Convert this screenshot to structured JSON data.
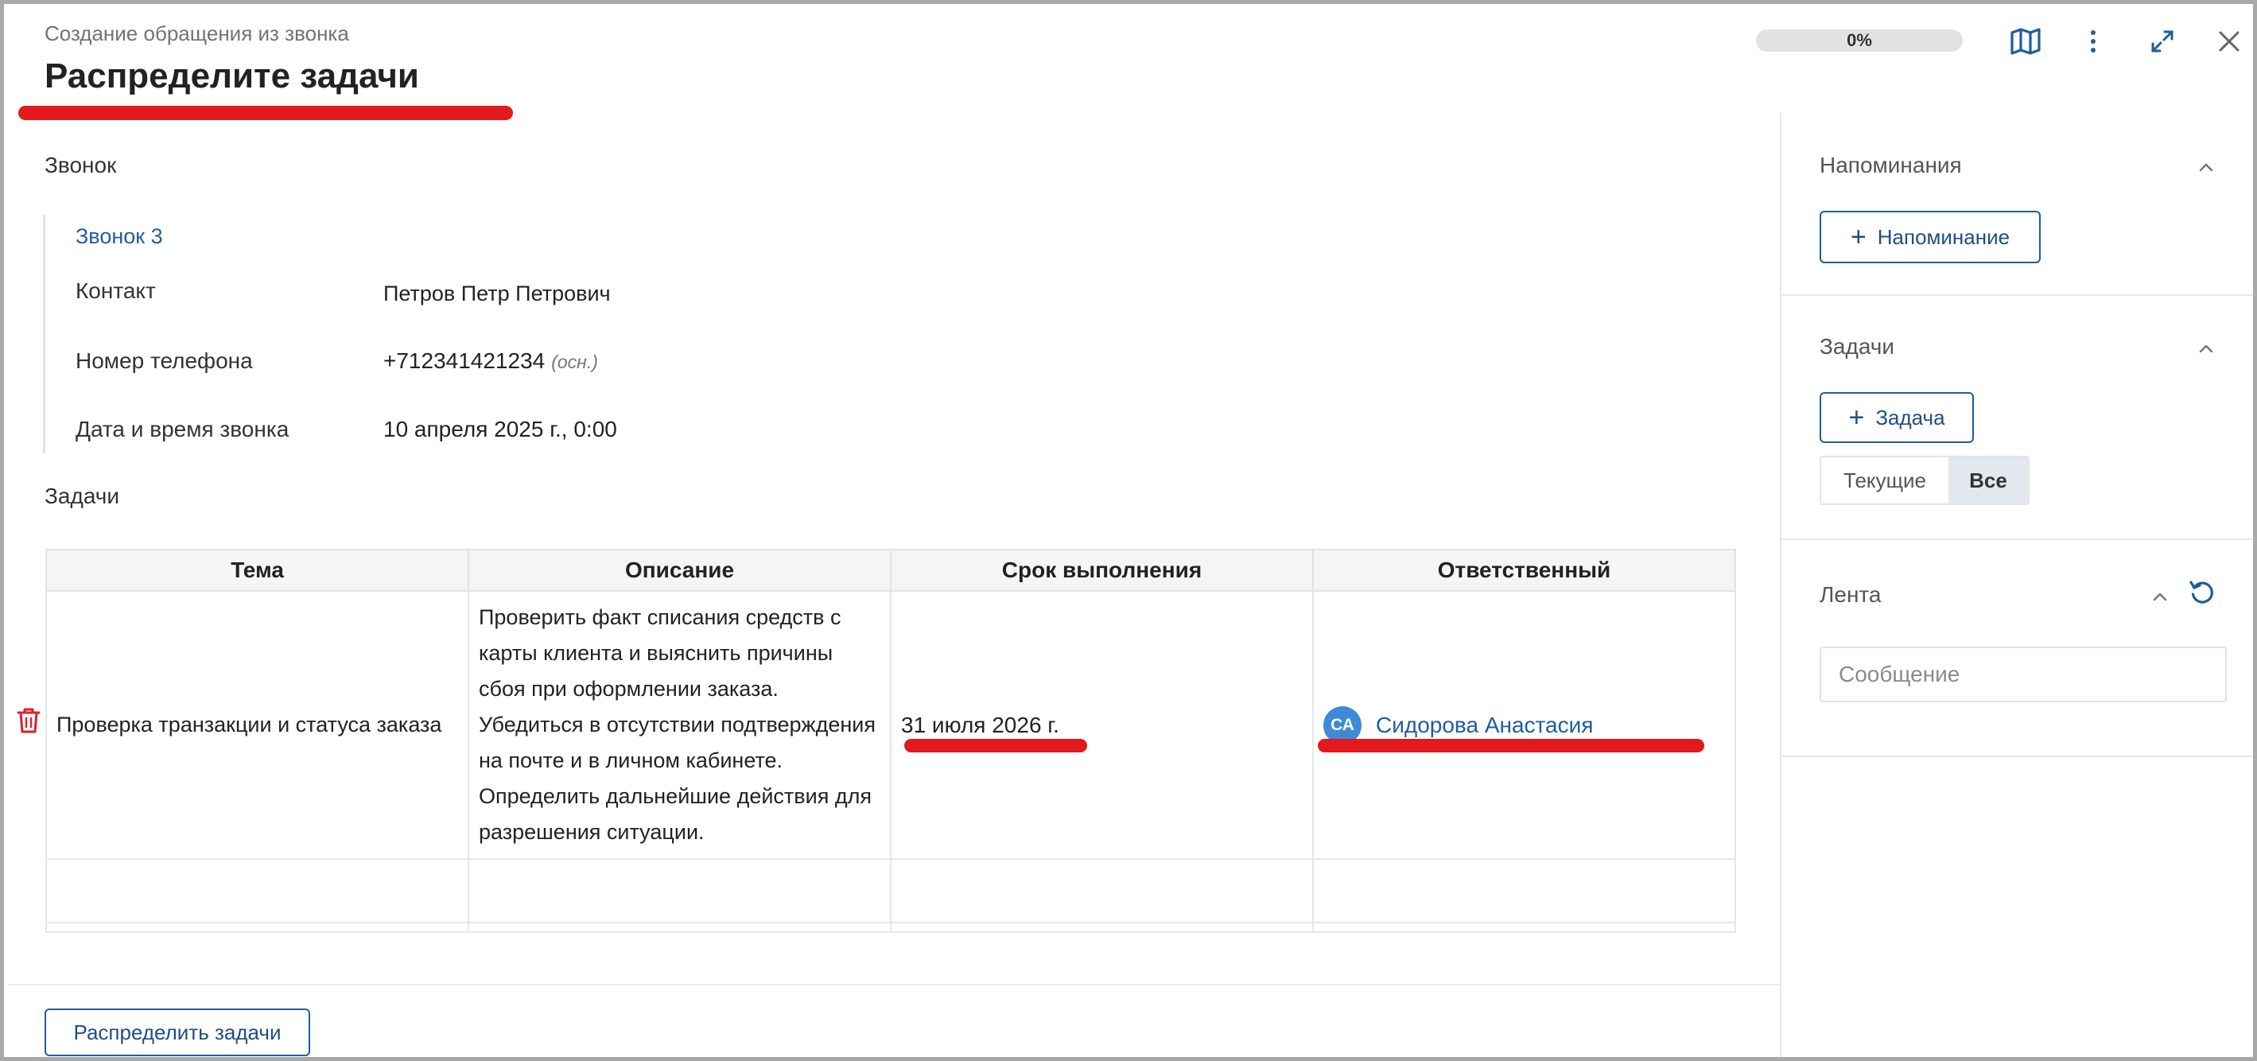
{
  "header": {
    "breadcrumb": "Создание обращения из звонка",
    "title": "Распределите задачи",
    "progress_label": "0%",
    "progress_fraction": 0
  },
  "call": {
    "section_label": "Звонок",
    "call_link": "Звонок 3",
    "fields": [
      {
        "label": "Контакт",
        "value": "Петров Петр Петрович"
      },
      {
        "label": "Номер телефона",
        "value": "+712341421234",
        "hint": "(осн.)"
      },
      {
        "label": "Дата и время звонка",
        "value": "10 апреля 2025 г., 0:00"
      }
    ]
  },
  "tasks": {
    "section_label": "Задачи",
    "columns": [
      "Тема",
      "Описание",
      "Срок выполнения",
      "Ответственный"
    ],
    "rows": [
      {
        "subject": "Проверка транзакции и статуса заказа",
        "description": "Проверить факт списания средств с карты клиента и выяснить причины сбоя при оформлении заказа. Убедиться в отсутствии подтверждения на почте и в личном кабинете. Определить дальнейшие действия для разрешения ситуации.",
        "due": "31 июля 2026 г.",
        "assignee_initials": "СА",
        "assignee": "Сидорова Анастасия"
      }
    ]
  },
  "footer": {
    "distribute_button": "Распределить задачи"
  },
  "right_panel": {
    "reminders": {
      "title": "Напоминания",
      "add_button": "Напоминание"
    },
    "tasks": {
      "title": "Задачи",
      "add_button": "Задача",
      "filter_current": "Текущие",
      "filter_all": "Все"
    },
    "feed": {
      "title": "Лента",
      "message_placeholder": "Сообщение"
    }
  },
  "colors": {
    "accent_blue": "#1e5d9e",
    "highlight_red": "#e3191c",
    "avatar_blue": "#3d8bd6"
  },
  "icons": [
    "map-icon",
    "more-vertical-icon",
    "expand-icon",
    "close-icon",
    "trash-icon",
    "chevron-up-icon",
    "refresh-icon",
    "plus-icon"
  ]
}
